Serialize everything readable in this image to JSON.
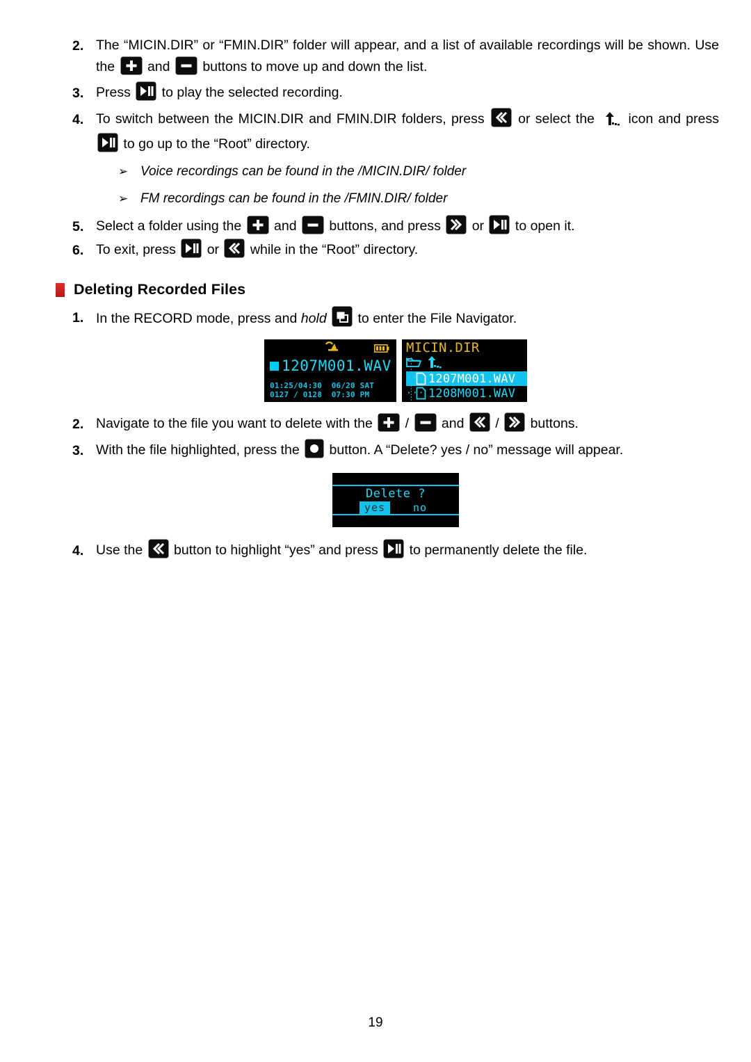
{
  "page": {
    "number": "19"
  },
  "steps_top": [
    {
      "num": "2.",
      "parts": [
        {
          "t": "text",
          "v": "The “MICIN.DIR” or “FMIN.DIR” folder will appear, and a list of available recordings will be shown. Use the "
        },
        {
          "t": "icon",
          "v": "plus-button"
        },
        {
          "t": "text",
          "v": " and "
        },
        {
          "t": "icon",
          "v": "minus-button"
        },
        {
          "t": "text",
          "v": " buttons to move up and down the list."
        }
      ]
    },
    {
      "num": "3.",
      "parts": [
        {
          "t": "text",
          "v": "Press "
        },
        {
          "t": "icon",
          "v": "play-pause-button"
        },
        {
          "t": "text",
          "v": " to play the selected recording."
        }
      ]
    },
    {
      "num": "4.",
      "parts": [
        {
          "t": "text",
          "v": "To switch between the MICIN.DIR and FMIN.DIR folders, press "
        },
        {
          "t": "icon",
          "v": "rewind-button"
        },
        {
          "t": "text",
          "v": " or select the "
        },
        {
          "t": "icon",
          "v": "up-directory-icon"
        },
        {
          "t": "text",
          "v": " icon and press "
        },
        {
          "t": "icon",
          "v": "play-pause-button"
        },
        {
          "t": "text",
          "v": " to go up to the “Root” directory."
        }
      ]
    }
  ],
  "notes": [
    {
      "marker": "➢",
      "text": "Voice recordings can be found in the /MICIN.DIR/ folder"
    },
    {
      "marker": "➢",
      "text": "FM recordings can be found in the /FMIN.DIR/ folder"
    }
  ],
  "steps_mid": [
    {
      "num": "5.",
      "parts": [
        {
          "t": "text",
          "v": "Select a folder using the "
        },
        {
          "t": "icon",
          "v": "plus-button"
        },
        {
          "t": "text",
          "v": " and "
        },
        {
          "t": "icon",
          "v": "minus-button"
        },
        {
          "t": "text",
          "v": " buttons, and press "
        },
        {
          "t": "icon",
          "v": "fast-forward-button"
        },
        {
          "t": "text",
          "v": " or "
        },
        {
          "t": "icon",
          "v": "play-pause-button"
        },
        {
          "t": "text",
          "v": " to open it."
        }
      ]
    },
    {
      "num": "6.",
      "parts": [
        {
          "t": "text",
          "v": "To exit, press "
        },
        {
          "t": "icon",
          "v": "play-pause-button"
        },
        {
          "t": "text",
          "v": " or "
        },
        {
          "t": "icon",
          "v": "rewind-button"
        },
        {
          "t": "text",
          "v": " while in the “Root” directory."
        }
      ]
    }
  ],
  "section": {
    "title": "Deleting Recorded Files",
    "bullet_color": "#d32020"
  },
  "steps_delete": [
    {
      "num": "1.",
      "parts": [
        {
          "t": "text",
          "v": "In the RECORD mode, press and "
        },
        {
          "t": "italic",
          "v": "hold"
        },
        {
          "t": "text",
          "v": " "
        },
        {
          "t": "icon",
          "v": "file-navigator-button"
        },
        {
          "t": "text",
          "v": " to enter the File Navigator."
        }
      ]
    },
    {
      "num": "2.",
      "parts": [
        {
          "t": "text",
          "v": "Navigate to the file you want to delete with the "
        },
        {
          "t": "icon",
          "v": "plus-button"
        },
        {
          "t": "text",
          "v": " / "
        },
        {
          "t": "icon",
          "v": "minus-button"
        },
        {
          "t": "text",
          "v": " and "
        },
        {
          "t": "icon",
          "v": "rewind-button"
        },
        {
          "t": "text",
          "v": " / "
        },
        {
          "t": "icon",
          "v": "fast-forward-button"
        },
        {
          "t": "text",
          "v": " buttons."
        }
      ]
    },
    {
      "num": "3.",
      "parts": [
        {
          "t": "text",
          "v": "With the file highlighted, press the "
        },
        {
          "t": "icon",
          "v": "record-button"
        },
        {
          "t": "text",
          "v": " button. A “Delete? yes / no” message will appear."
        }
      ]
    },
    {
      "num": "4.",
      "parts": [
        {
          "t": "text",
          "v": "Use the "
        },
        {
          "t": "icon",
          "v": "rewind-button"
        },
        {
          "t": "text",
          "v": " button to highlight “yes” and press "
        },
        {
          "t": "icon",
          "v": "play-pause-button"
        },
        {
          "t": "text",
          "v": " to permanently delete the file."
        }
      ]
    }
  ],
  "lcd_playback": {
    "mic_icon": "microphone-icon",
    "battery_icon": "battery-icon",
    "stop_marker": "stop-square",
    "track_name": "1207M001.WAV",
    "status_line1": "01:25/04:30  06/20 SAT",
    "status_line2": "0127 / 0128  07:30 PM",
    "colors": {
      "text": "#22d8f7",
      "accent": "#e8b71d",
      "background": "#000000"
    }
  },
  "lcd_navigator": {
    "dir_title": "MICIN.DIR",
    "folder_icon": "folder-icon",
    "up_icon": "up-directory-icon",
    "files": [
      {
        "name": "1207M001.WAV",
        "selected": true
      },
      {
        "name": "1208M001.WAV",
        "selected": false
      }
    ],
    "colors": {
      "title": "#e8b71d",
      "text": "#22d8f7",
      "highlight": "#11c3ec"
    }
  },
  "lcd_delete": {
    "prompt": "Delete ?",
    "yes_label": "yes",
    "no_label": "no",
    "selected": "yes",
    "colors": {
      "text": "#22d8f7",
      "highlight": "#11c3ec"
    }
  }
}
